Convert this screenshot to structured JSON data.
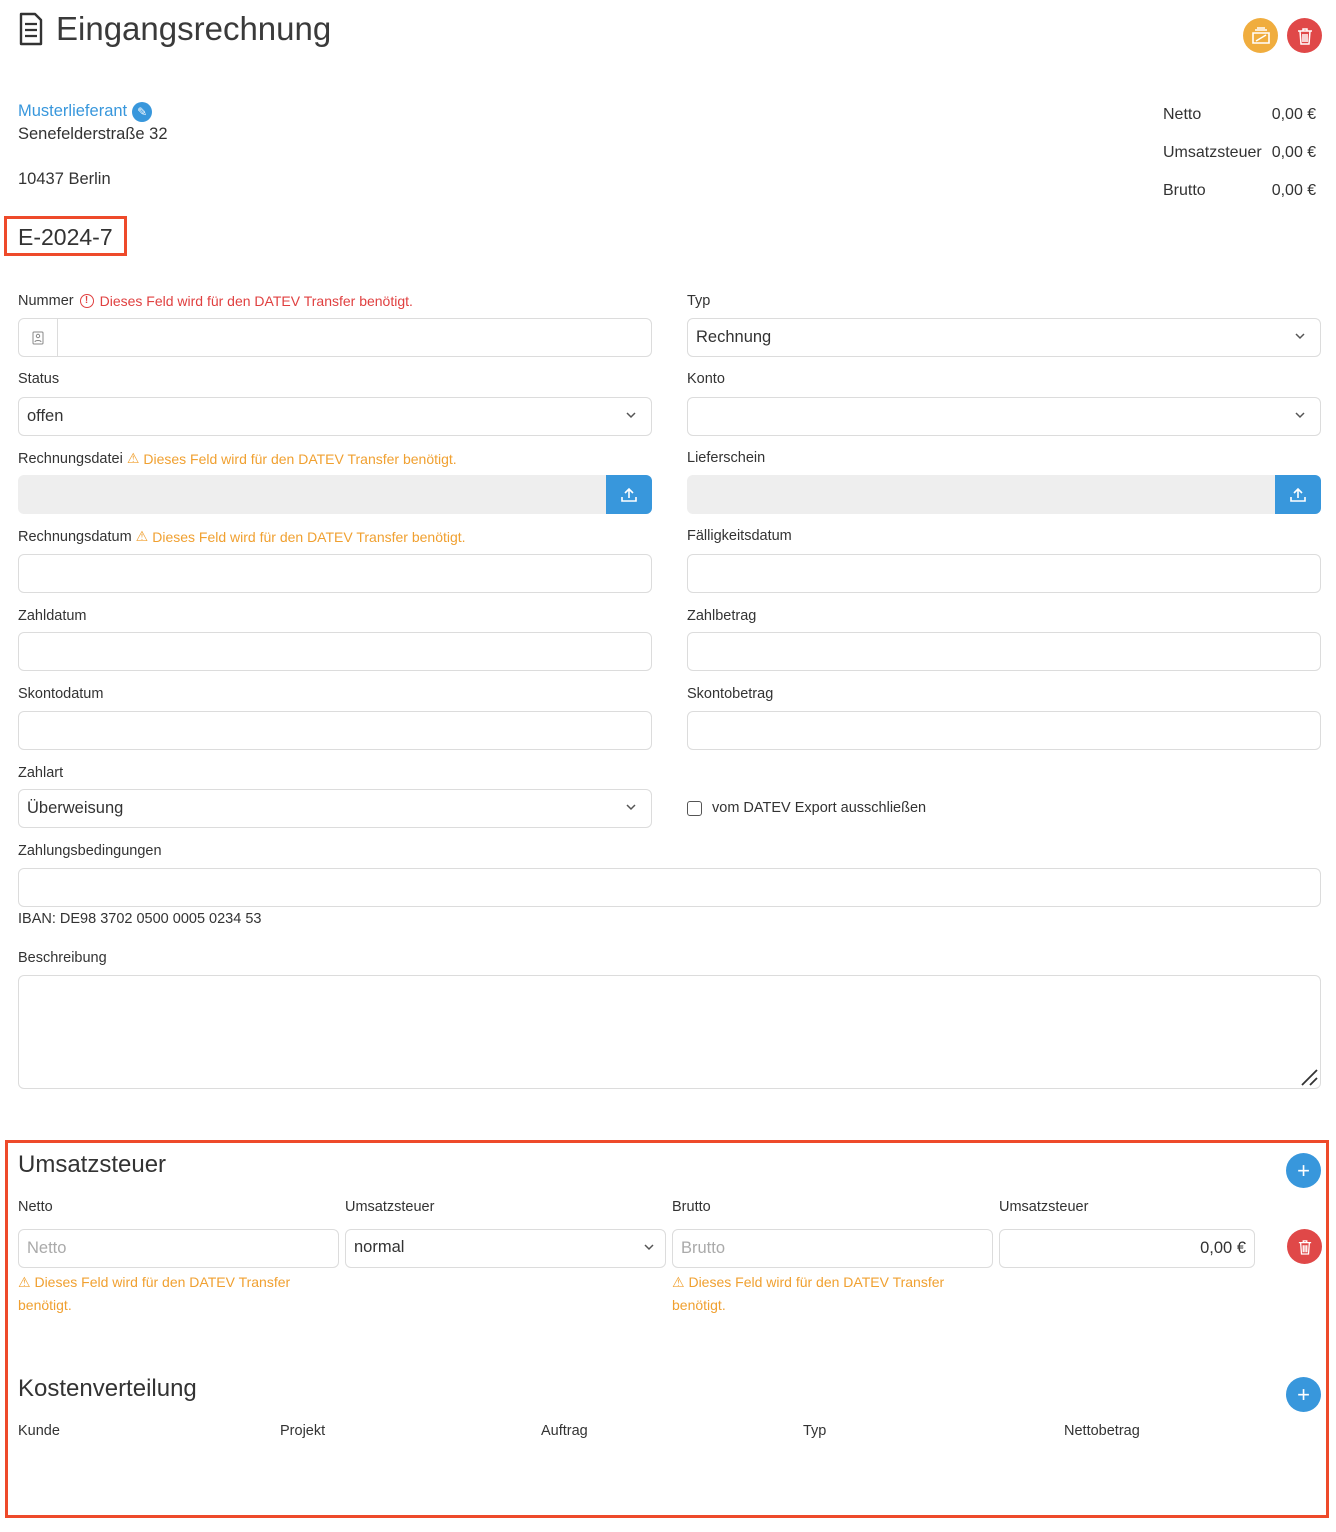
{
  "header": {
    "title": "Eingangsrechnung",
    "icon_archive": "archive-icon",
    "icon_delete": "trash-icon"
  },
  "supplier": {
    "name": "Musterlieferant",
    "street": "Senefelderstraße 32",
    "city": "10437 Berlin"
  },
  "totals": [
    {
      "label": "Netto",
      "value": "0,00 €"
    },
    {
      "label": "Umsatzsteuer",
      "value": "0,00 €"
    },
    {
      "label": "Brutto",
      "value": "0,00 €"
    }
  ],
  "invoice_id": "E-2024-7",
  "form": {
    "nummer_label": "Nummer",
    "nummer_error": "Dieses Feld wird für den DATEV Transfer benötigt.",
    "typ_label": "Typ",
    "typ_value": "Rechnung",
    "status_label": "Status",
    "status_value": "offen",
    "konto_label": "Konto",
    "rechnungsdatei_label": "Rechnungsdatei",
    "rechnungsdatei_warn": "Dieses Feld wird für den DATEV Transfer benötigt.",
    "lieferschein_label": "Lieferschein",
    "rechnungsdatum_label": "Rechnungsdatum",
    "rechnungsdatum_warn": "Dieses Feld wird für den DATEV Transfer benötigt.",
    "faelligkeitsdatum_label": "Fälligkeitsdatum",
    "zahldatum_label": "Zahldatum",
    "zahlbetrag_label": "Zahlbetrag",
    "skontodatum_label": "Skontodatum",
    "skontobetrag_label": "Skontobetrag",
    "zahlart_label": "Zahlart",
    "zahlart_value": "Überweisung",
    "datev_exclude_label": "vom DATEV Export ausschließen",
    "zahlungsbedingungen_label": "Zahlungsbedingungen",
    "iban": "IBAN: DE98 3702 0500 0005 0234 53",
    "beschreibung_label": "Beschreibung"
  },
  "vat": {
    "title": "Umsatzsteuer",
    "col_netto": "Netto",
    "col_ust": "Umsatzsteuer",
    "col_brutto": "Brutto",
    "col_ust_amount": "Umsatzsteuer",
    "netto_placeholder": "Netto",
    "ust_value": "normal",
    "brutto_placeholder": "Brutto",
    "ust_amount": "0,00 €",
    "warn": "Dieses Feld wird für den DATEV Transfer benötigt."
  },
  "costs": {
    "title": "Kostenverteilung",
    "cols": [
      "Kunde",
      "Projekt",
      "Auftrag",
      "Typ",
      "Nettobetrag"
    ]
  },
  "colors": {
    "primary": "#3897dc",
    "danger": "#e04848",
    "warning": "#f0a030",
    "highlight": "#ee4a2a"
  }
}
